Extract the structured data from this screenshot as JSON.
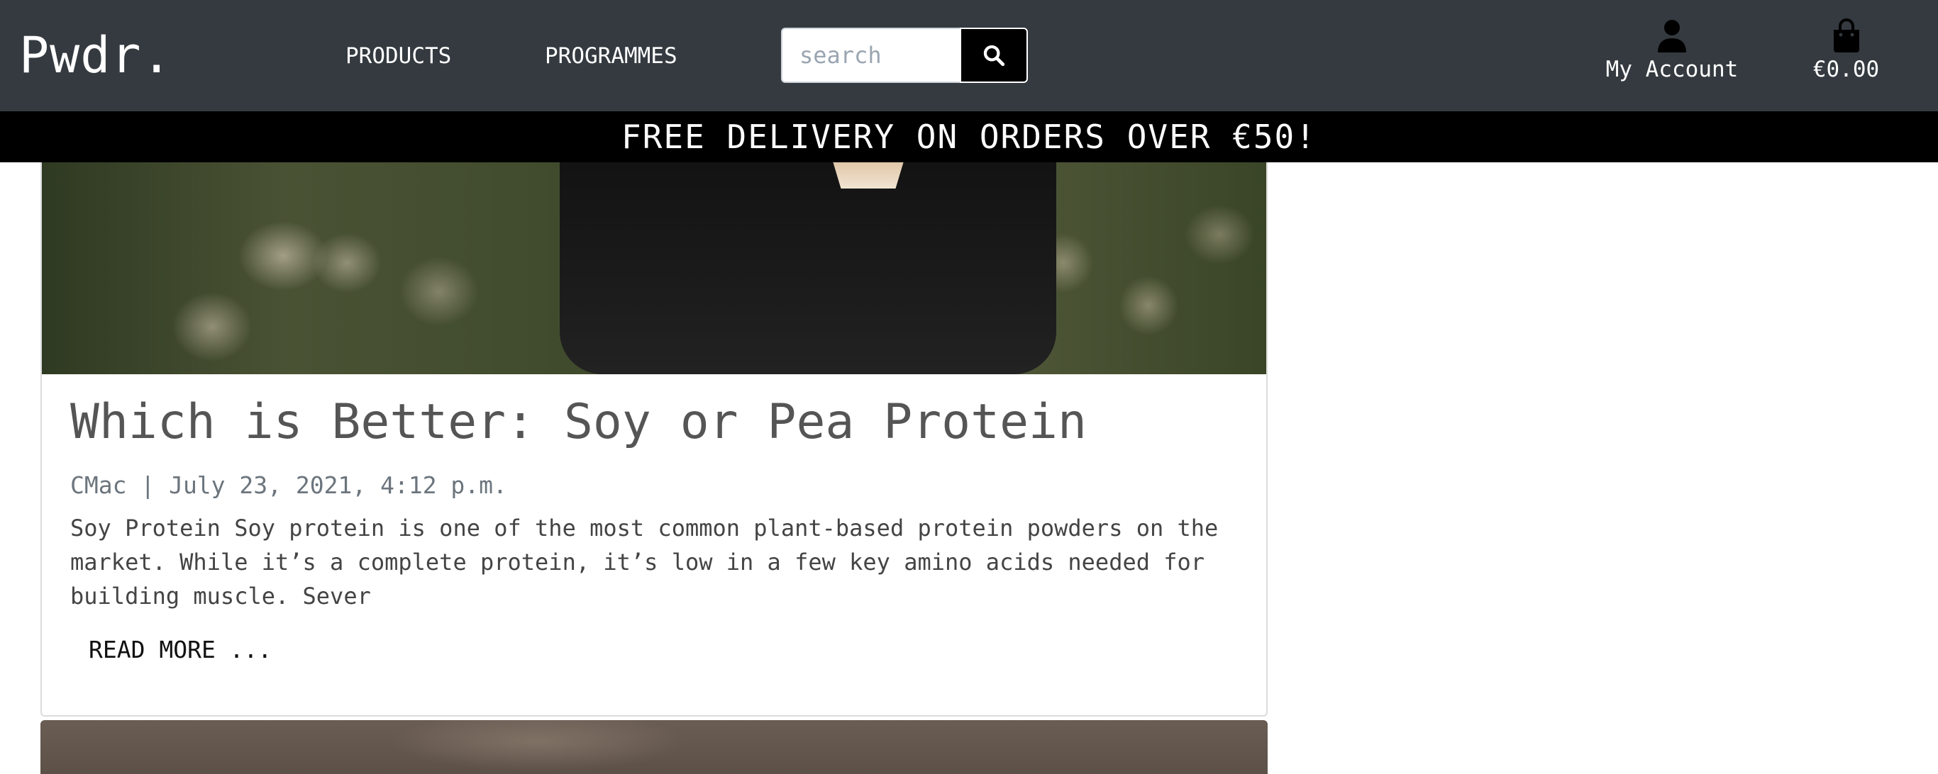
{
  "header": {
    "logo": "Pwdr.",
    "nav": [
      {
        "label": "PRODUCTS"
      },
      {
        "label": "PROGRAMMES"
      }
    ],
    "search": {
      "placeholder": "search",
      "button_icon": "search-icon"
    },
    "account": {
      "label": "My Account",
      "icon": "user-icon"
    },
    "cart": {
      "label": "€0.00",
      "icon": "shopping-bag-icon"
    }
  },
  "banner": {
    "text": "FREE DELIVERY ON ORDERS OVER €50!"
  },
  "post": {
    "title": "Which is Better: Soy or Pea Protein",
    "meta": "CMac | July 23, 2021, 4:12 p.m.",
    "excerpt": "Soy Protein Soy protein is one of the most common plant-based protein powders on the market. While it’s a complete protein, it’s low in a few key amino acids needed for building muscle. Sever",
    "read_more": "READ MORE ..."
  },
  "colors": {
    "header_bg": "#343a40",
    "banner_bg": "#000000",
    "text_muted": "#6c757d"
  }
}
